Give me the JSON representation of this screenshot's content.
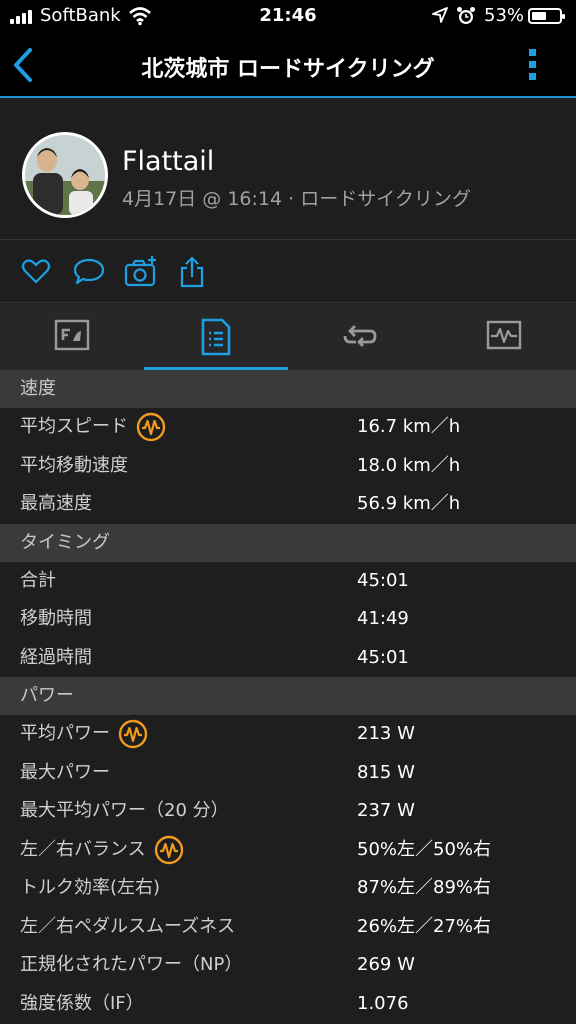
{
  "status_bar": {
    "carrier": "SoftBank",
    "time": "21:46",
    "battery": "53%",
    "battery_level": 0.53,
    "icons": [
      "signal-icon",
      "wifi-icon",
      "location-icon",
      "alarm-icon",
      "battery-icon"
    ]
  },
  "nav": {
    "title": "北茨城市 ロードサイクリング",
    "back_icon": "chevron-left-icon",
    "more_icon": "more-vertical-icon"
  },
  "activity": {
    "user_name": "Flattail",
    "meta": "4月17日 @ 16:14 · ロードサイクリング"
  },
  "actions": [
    "like-icon",
    "comment-icon",
    "add-photo-icon",
    "share-icon"
  ],
  "tabs": [
    {
      "icon": "overview-icon",
      "active": false
    },
    {
      "icon": "stats-list-icon",
      "active": true
    },
    {
      "icon": "laps-icon",
      "active": false
    },
    {
      "icon": "charts-icon",
      "active": false
    }
  ],
  "colors": {
    "accent": "#1f9fe3",
    "badge": "#f29b1d",
    "section_bg": "#3a3a3a",
    "background": "#1e1e1e"
  },
  "sections": [
    {
      "title": "速度",
      "rows": [
        {
          "label": "平均スピード",
          "value": "16.7 km／h",
          "badge": true
        },
        {
          "label": "平均移動速度",
          "value": "18.0 km／h",
          "badge": false
        },
        {
          "label": "最高速度",
          "value": "56.9 km／h",
          "badge": false
        }
      ]
    },
    {
      "title": "タイミング",
      "rows": [
        {
          "label": "合計",
          "value": "45:01",
          "badge": false
        },
        {
          "label": "移動時間",
          "value": "41:49",
          "badge": false
        },
        {
          "label": "経過時間",
          "value": "45:01",
          "badge": false
        }
      ]
    },
    {
      "title": "パワー",
      "rows": [
        {
          "label": "平均パワー",
          "value": "213 W",
          "badge": true
        },
        {
          "label": "最大パワー",
          "value": "815 W",
          "badge": false
        },
        {
          "label": "最大平均パワー（20 分）",
          "value": "237 W",
          "badge": false
        },
        {
          "label": "左／右バランス",
          "value": "50%左／50%右",
          "badge": true
        },
        {
          "label": "トルク効率(左右)",
          "value": "87%左／89%右",
          "badge": false
        },
        {
          "label": "左／右ペダルスムーズネス",
          "value": "26%左／27%右",
          "badge": false
        },
        {
          "label": "正規化されたパワー（NP）",
          "value": "269 W",
          "badge": false
        },
        {
          "label": "強度係数（IF）",
          "value": "1.076",
          "badge": false
        }
      ]
    }
  ]
}
